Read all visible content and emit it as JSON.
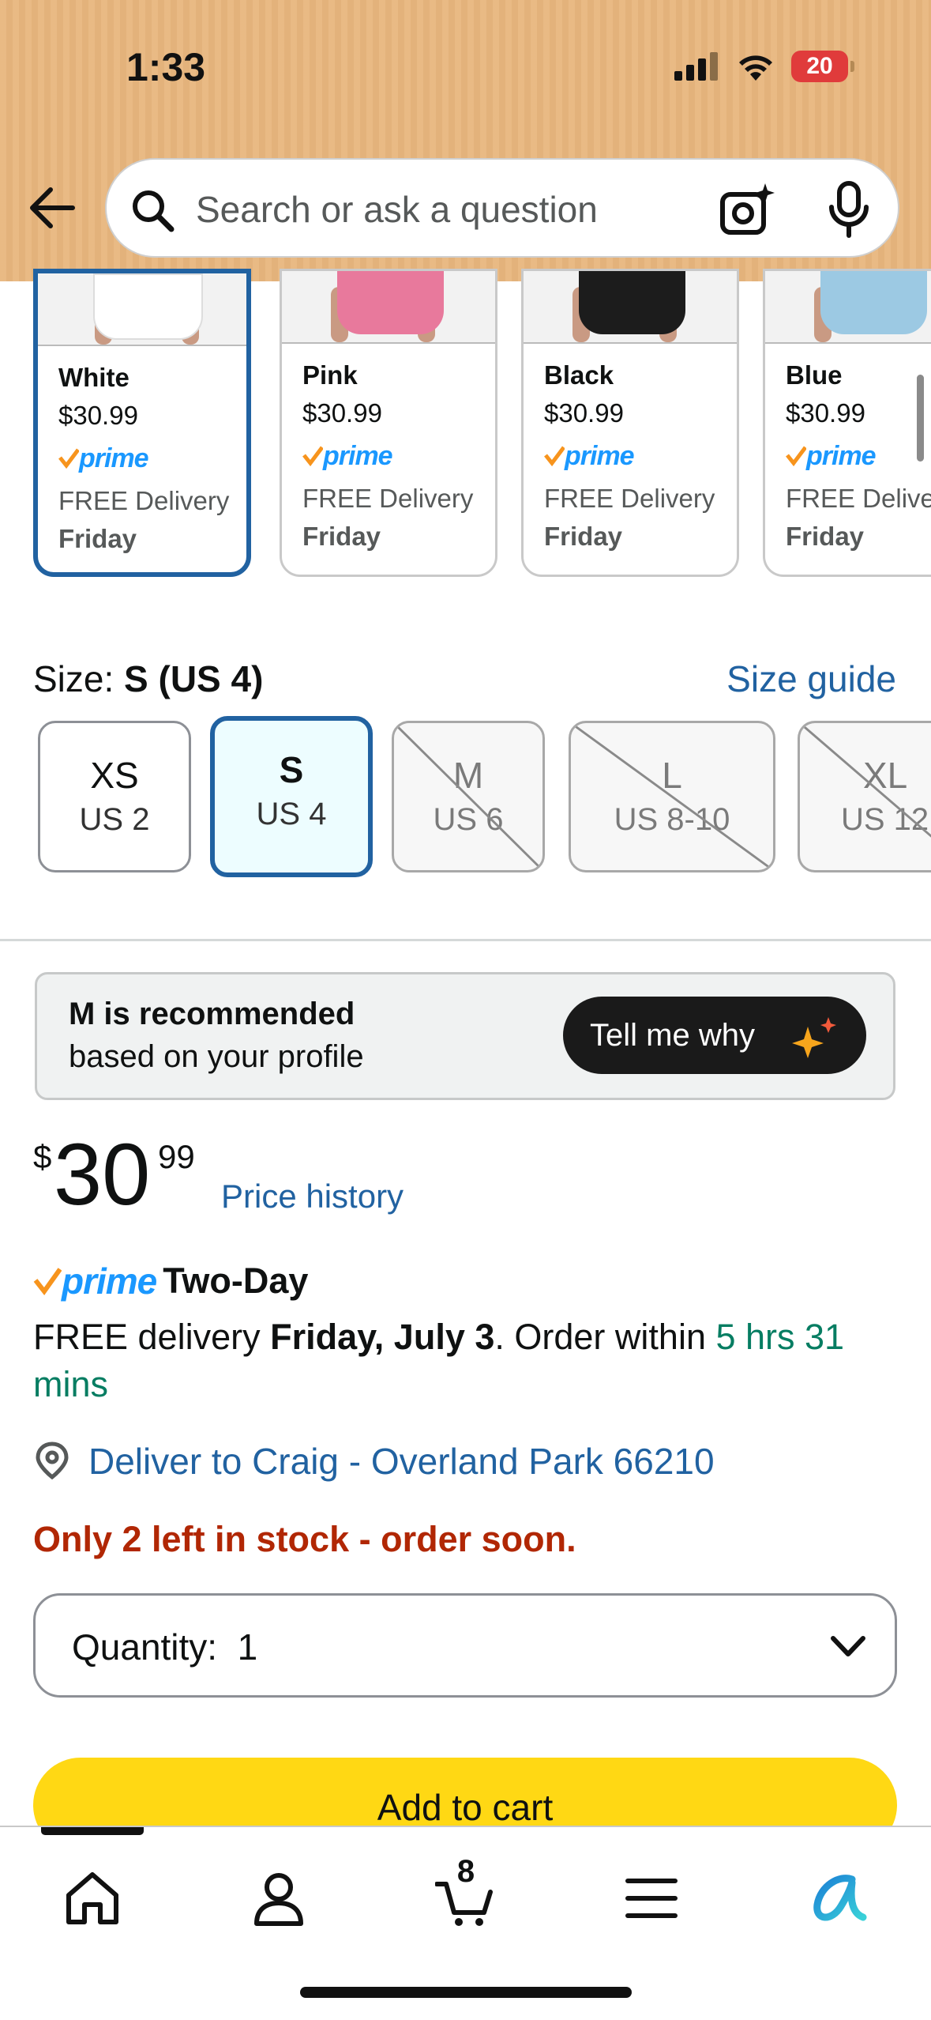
{
  "status_bar": {
    "time": "1:33",
    "battery": "20"
  },
  "search": {
    "placeholder": "Search or ask a question"
  },
  "colors": [
    {
      "name": "White",
      "price": "$30.99",
      "prime": "prime",
      "delivery": "FREE Delivery",
      "day": "Friday",
      "swatch": "#ffffff",
      "selected": true
    },
    {
      "name": "Pink",
      "price": "$30.99",
      "prime": "prime",
      "delivery": "FREE Delivery",
      "day": "Friday",
      "swatch": "#e8799c",
      "selected": false
    },
    {
      "name": "Black",
      "price": "$30.99",
      "prime": "prime",
      "delivery": "FREE Delivery",
      "day": "Friday",
      "swatch": "#1c1c1c",
      "selected": false
    },
    {
      "name": "Blue",
      "price": "$30.99",
      "prime": "prime",
      "delivery": "FREE Delivery",
      "day": "Friday",
      "swatch": "#9cc9e3",
      "selected": false
    }
  ],
  "size": {
    "label": "Size: ",
    "selected": "S (US 4)",
    "guide": "Size guide",
    "options": [
      {
        "size": "XS",
        "us": "US 2",
        "state": "available"
      },
      {
        "size": "S",
        "us": "US 4",
        "state": "selected"
      },
      {
        "size": "M",
        "us": "US 6",
        "state": "unavailable"
      },
      {
        "size": "L",
        "us": "US 8-10",
        "state": "unavailable"
      },
      {
        "size": "XL",
        "us": "US 12",
        "state": "unavailable"
      }
    ]
  },
  "recommendation": {
    "line1": "M is recommended",
    "line2": "based on your profile",
    "button": "Tell me why"
  },
  "price": {
    "currency": "$",
    "whole": "30",
    "fraction": "99",
    "history_link": "Price history"
  },
  "prime_delivery": {
    "prime": "prime",
    "speed": "Two-Day",
    "prefix": "FREE delivery ",
    "date": "Friday, July 3",
    "middle": ". Order within ",
    "countdown": "5 hrs 31 mins"
  },
  "deliver_to": "Deliver to Craig - Overland Park 66210",
  "stock": "Only 2 left in stock - order soon.",
  "quantity": {
    "label": "Quantity:",
    "value": "1"
  },
  "add_to_cart": "Add to cart",
  "tabbar": {
    "cart_count": "8"
  },
  "colors_theme": {
    "header_bg": "#e8b67e",
    "link": "#2162a1",
    "selected_border": "#2162a1",
    "stock_red": "#b12704",
    "countdown_green": "#067d62",
    "prime_blue": "#1a98ff",
    "add_to_cart_yellow": "#ffd814"
  }
}
